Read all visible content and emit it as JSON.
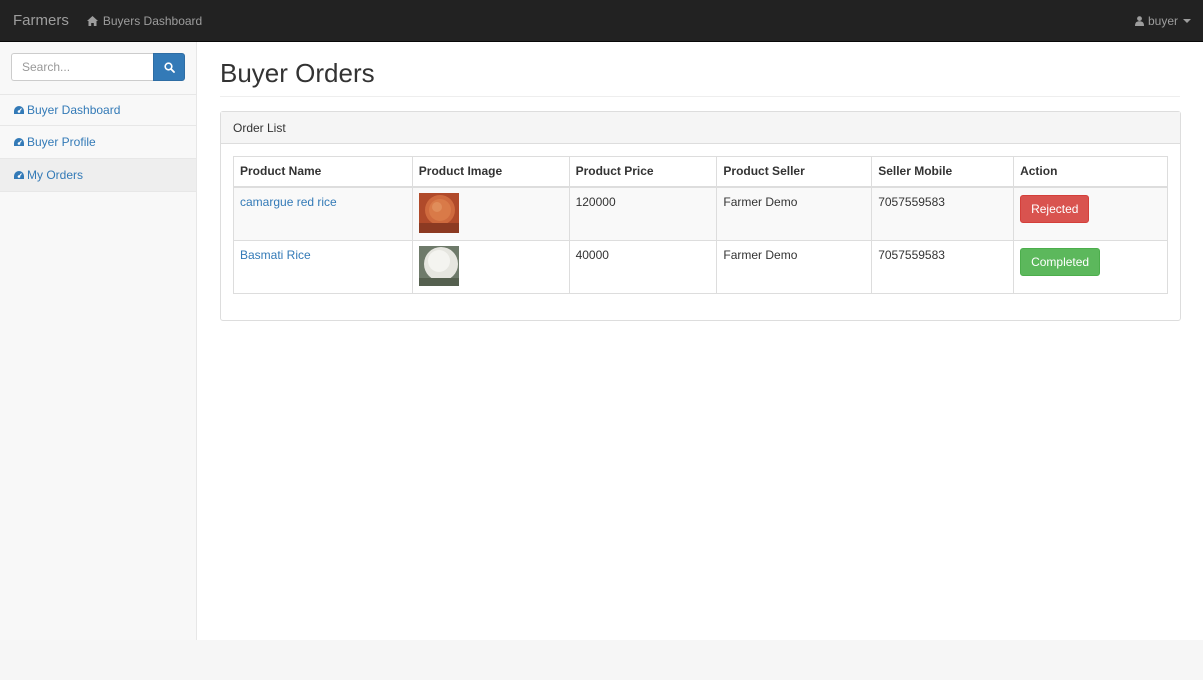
{
  "navbar": {
    "brand": "Farmers",
    "dashboard_link": "Buyers Dashboard",
    "user": "buyer"
  },
  "sidebar": {
    "search_placeholder": "Search...",
    "items": [
      {
        "label": "Buyer Dashboard"
      },
      {
        "label": "Buyer Profile"
      },
      {
        "label": "My Orders",
        "active": true
      }
    ]
  },
  "main": {
    "title": "Buyer Orders",
    "panel_title": "Order List",
    "columns": [
      "Product Name",
      "Product Image",
      "Product Price",
      "Product Seller",
      "Seller Mobile",
      "Action"
    ],
    "rows": [
      {
        "name": "camargue red rice",
        "image": "red-rice-image",
        "price": "120000",
        "seller": "Farmer Demo",
        "mobile": "7057559583",
        "action": "Rejected"
      },
      {
        "name": "Basmati Rice",
        "image": "basmati-rice-image",
        "price": "40000",
        "seller": "Farmer Demo",
        "mobile": "7057559583",
        "action": "Completed"
      }
    ]
  },
  "colors": {
    "navbar_bg": "#222222",
    "link": "#337ab7",
    "danger": "#d9534f",
    "success": "#5cb85c"
  },
  "icons": {
    "home": "home-icon",
    "user": "user-icon",
    "search": "search-icon",
    "menu": "dashboard-icon"
  }
}
